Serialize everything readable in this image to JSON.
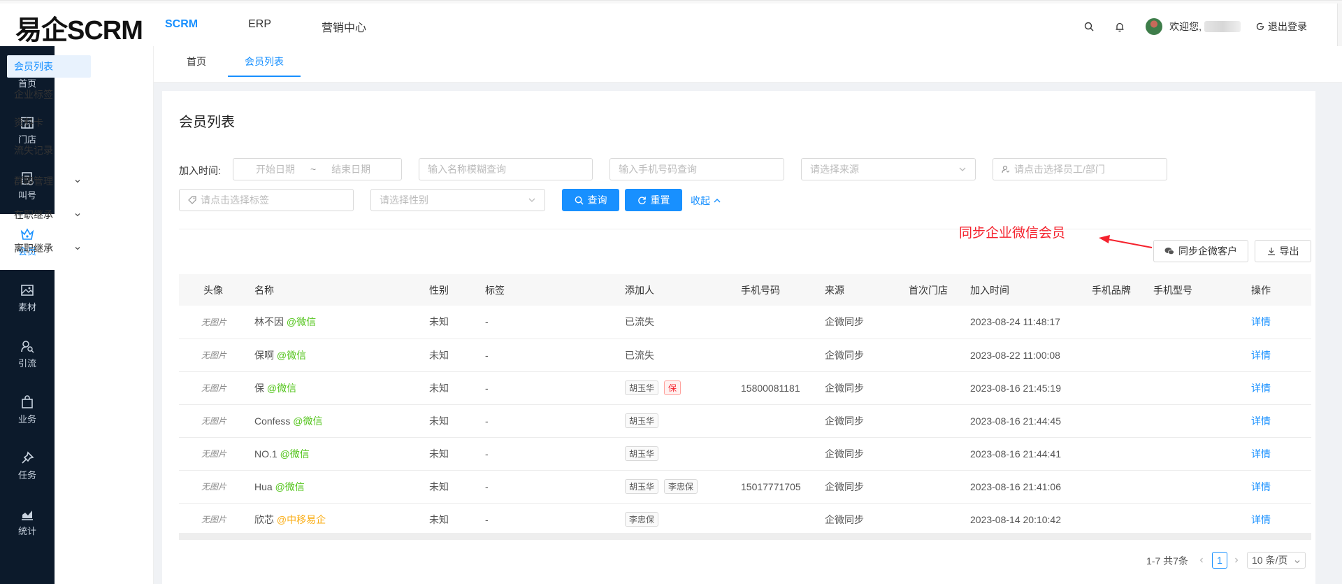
{
  "app": {
    "logo": "易企SCRM"
  },
  "topnav": {
    "items": [
      "SCRM",
      "ERP",
      "营销中心"
    ],
    "active": "SCRM"
  },
  "header": {
    "welcome": "欢迎您,",
    "logout": "退出登录"
  },
  "sidebar": {
    "items": [
      "首页",
      "门店",
      "叫号",
      "会员",
      "素材",
      "引流",
      "业务",
      "任务",
      "统计"
    ],
    "active": "会员"
  },
  "submenu": {
    "items": [
      "会员列表",
      "企业标签",
      "资料卡",
      "流失记录",
      "群聊管理",
      "在职继承",
      "离职继承"
    ]
  },
  "tabs": [
    "首页",
    "会员列表"
  ],
  "page": {
    "title": "会员列表"
  },
  "filters": {
    "join_time_label": "加入时间:",
    "start_date_placeholder": "开始日期",
    "range_sep": "~",
    "end_date_placeholder": "结束日期",
    "name_placeholder": "输入名称模糊查询",
    "phone_placeholder": "输入手机号码查询",
    "source_placeholder": "请选择来源",
    "staff_placeholder": "请点击选择员工/部门",
    "tag_placeholder": "请点击选择标签",
    "gender_placeholder": "请选择性别",
    "search_label": "查询",
    "reset_label": "重置",
    "collapse_label": "收起"
  },
  "annotation": "同步企业微信会员",
  "actions": {
    "sync_label": "同步企微客户",
    "export_label": "导出"
  },
  "table": {
    "headers": [
      "头像",
      "名称",
      "性别",
      "标签",
      "添加人",
      "手机号码",
      "来源",
      "首次门店",
      "加入时间",
      "手机品牌",
      "手机型号",
      "操作"
    ],
    "rows": [
      {
        "avatar": "无图片",
        "name": "林不因",
        "channel": "@微信",
        "gender": "未知",
        "tag": "-",
        "adder_text": "已流失",
        "adders": [],
        "phone": "",
        "source": "企微同步",
        "store": "",
        "joined": "2023-08-24 11:48:17",
        "action": "详情"
      },
      {
        "avatar": "无图片",
        "name": "保啊",
        "channel": "@微信",
        "gender": "未知",
        "tag": "-",
        "adder_text": "已流失",
        "adders": [],
        "phone": "",
        "source": "企微同步",
        "store": "",
        "joined": "2023-08-22 11:00:08",
        "action": "详情"
      },
      {
        "avatar": "无图片",
        "name": "保",
        "channel": "@微信",
        "gender": "未知",
        "tag": "-",
        "adder_text": "",
        "adders": [
          "胡玉华",
          "保"
        ],
        "phone": "15800081181",
        "source": "企微同步",
        "store": "",
        "joined": "2023-08-16 21:45:19",
        "action": "详情"
      },
      {
        "avatar": "无图片",
        "name": "Confess",
        "channel": "@微信",
        "gender": "未知",
        "tag": "-",
        "adder_text": "",
        "adders": [
          "胡玉华"
        ],
        "phone": "",
        "source": "企微同步",
        "store": "",
        "joined": "2023-08-16 21:44:45",
        "action": "详情"
      },
      {
        "avatar": "无图片",
        "name": "NO.1",
        "channel": "@微信",
        "gender": "未知",
        "tag": "-",
        "adder_text": "",
        "adders": [
          "胡玉华"
        ],
        "phone": "",
        "source": "企微同步",
        "store": "",
        "joined": "2023-08-16 21:44:41",
        "action": "详情"
      },
      {
        "avatar": "无图片",
        "name": "Hua",
        "channel": "@微信",
        "gender": "未知",
        "tag": "-",
        "adder_text": "",
        "adders": [
          "胡玉华",
          "李忠保"
        ],
        "phone": "15017771705",
        "source": "企微同步",
        "store": "",
        "joined": "2023-08-16 21:41:06",
        "action": "详情"
      },
      {
        "avatar": "无图片",
        "name": "欣芯",
        "channel": "@中移易企",
        "gender": "未知",
        "tag": "-",
        "adder_text": "",
        "adders": [
          "李忠保"
        ],
        "phone": "",
        "source": "企微同步",
        "store": "",
        "joined": "2023-08-14 20:10:42",
        "action": "详情"
      }
    ]
  },
  "pagination": {
    "summary": "1-7 共7条",
    "current": "1",
    "page_size": "10 条/页"
  },
  "colors": {
    "primary": "#1890ff",
    "sidebar_bg": "#0c1a2b",
    "wechat": "#52c41a",
    "corp": "#faad14",
    "annotation": "#f5222d"
  }
}
